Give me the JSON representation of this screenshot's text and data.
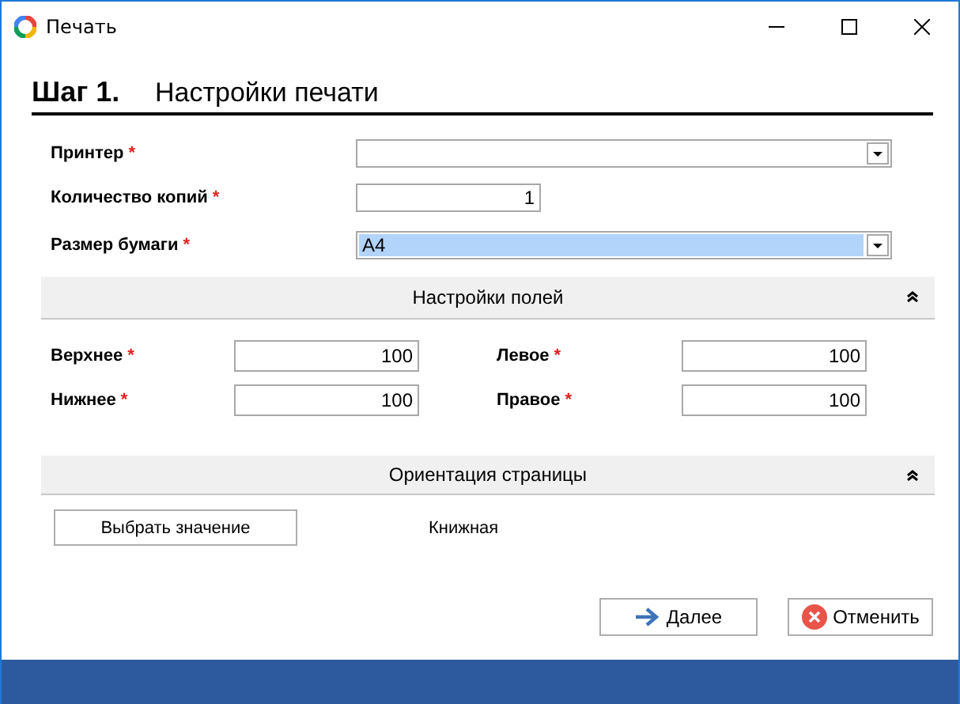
{
  "window": {
    "title": "Печать"
  },
  "step": {
    "number": "Шаг 1.",
    "title": "Настройки печати"
  },
  "fields": [
    {
      "label": "Принтер",
      "required_mark": "*",
      "kind": "dropdown"
    },
    {
      "label": "Количество копий",
      "required_mark": "*",
      "kind": "number",
      "value": "1"
    },
    {
      "label": "Размер бумаги",
      "required_mark": "*",
      "kind": "dropdown",
      "value": "A4",
      "highlighted": true
    }
  ],
  "margins_section": {
    "title": "Настройки полей",
    "expanded": true,
    "fields": [
      {
        "label": "Верхнее",
        "required_mark": "*",
        "value": "100"
      },
      {
        "label": "Левое",
        "required_mark": "*",
        "value": "100"
      },
      {
        "label": "Нижнее",
        "required_mark": "*",
        "value": "100"
      },
      {
        "label": "Правое",
        "required_mark": "*",
        "value": "100"
      }
    ]
  },
  "orientation_section": {
    "title": "Ориентация страницы",
    "expanded": true,
    "button": "Выбрать значение",
    "value": "Книжная"
  },
  "buttons": [
    {
      "kind": "next",
      "label": "Далее"
    },
    {
      "kind": "cancel",
      "label": "Отменить"
    }
  ]
}
